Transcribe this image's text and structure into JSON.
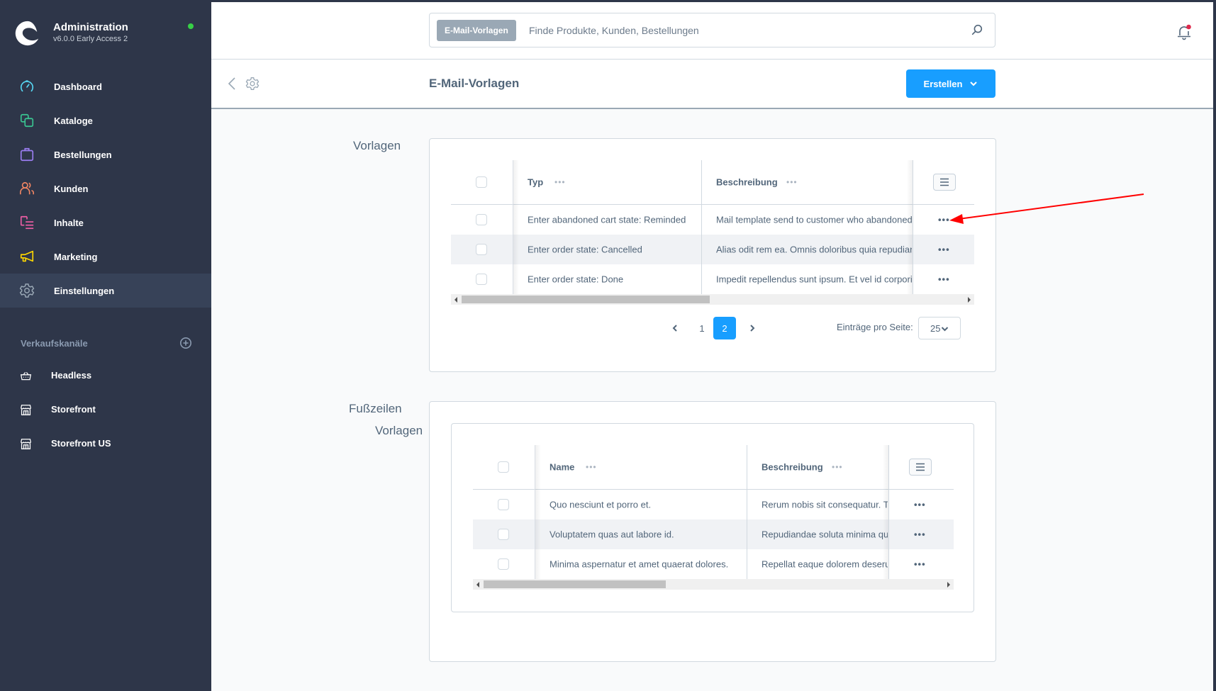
{
  "sidebar": {
    "brand": {
      "title": "Administration",
      "version": "v6.0.0 Early Access 2",
      "status": "online"
    },
    "nav": [
      {
        "label": "Dashboard",
        "icon": "dashboard-icon",
        "color": "#57d9f5",
        "active": false
      },
      {
        "label": "Kataloge",
        "icon": "catalog-icon",
        "color": "#3ac692",
        "active": false
      },
      {
        "label": "Bestellungen",
        "icon": "shopping-bag-icon",
        "color": "#9b7ef2",
        "active": false
      },
      {
        "label": "Kunden",
        "icon": "customers-icon",
        "color": "#f08563",
        "active": false
      },
      {
        "label": "Inhalte",
        "icon": "content-icon",
        "color": "#ee5ea5",
        "active": false
      },
      {
        "label": "Marketing",
        "icon": "megaphone-icon",
        "color": "#ffd700",
        "active": false
      },
      {
        "label": "Einstellungen",
        "icon": "settings-icon",
        "color": "#9aa8b5",
        "active": true
      }
    ],
    "sales_channels": {
      "title": "Verkaufskanäle",
      "items": [
        {
          "label": "Headless",
          "icon": "basket-icon"
        },
        {
          "label": "Storefront",
          "icon": "storefront-icon"
        },
        {
          "label": "Storefront US",
          "icon": "storefront-icon"
        }
      ]
    }
  },
  "topbar": {
    "search": {
      "badge": "E-Mail-Vorlagen",
      "placeholder": "Finde Produkte, Kunden, Bestellungen",
      "value": ""
    },
    "notifications": {
      "has_unread": true
    }
  },
  "page_header": {
    "title": "E-Mail-Vorlagen",
    "create_button": "Erstellen"
  },
  "templates_section": {
    "label": "Vorlagen",
    "columns": [
      "Typ",
      "Beschreibung"
    ],
    "rows": [
      {
        "type": "Enter abandoned cart state: Reminded",
        "description": "Mail template send to customer who abandoned cart"
      },
      {
        "type": "Enter order state: Cancelled",
        "description": "Alias odit rem ea. Omnis doloribus quia repudiandae"
      },
      {
        "type": "Enter order state: Done",
        "description": "Impedit repellendus sunt ipsum. Et vel id corporis"
      }
    ],
    "row_action": "•••",
    "column_menu": "•••",
    "pagination": {
      "pages": [
        "1",
        "2"
      ],
      "current": "2",
      "per_page_label": "Einträge pro Seite:",
      "per_page_value": "25"
    }
  },
  "footer_section": {
    "label_line1": "Fußzeilen",
    "label_line2": "Vorlagen",
    "columns": [
      "Name",
      "Beschreibung"
    ],
    "rows": [
      {
        "name": "Quo nesciunt et porro et.",
        "description": "Rerum nobis sit consequatur. Tempore"
      },
      {
        "name": "Voluptatem quas aut labore id.",
        "description": "Repudiandae soluta minima quia"
      },
      {
        "name": "Minima aspernatur et amet quaerat dolores.",
        "description": "Repellat eaque dolorem deserunt"
      }
    ],
    "row_action": "•••",
    "column_menu": "•••"
  },
  "colors": {
    "sidebar_bg": "#2e3649",
    "sidebar_active_bg": "#374258",
    "primary": "#189eff",
    "text": "#52667a",
    "annotation": "#ff0000"
  }
}
